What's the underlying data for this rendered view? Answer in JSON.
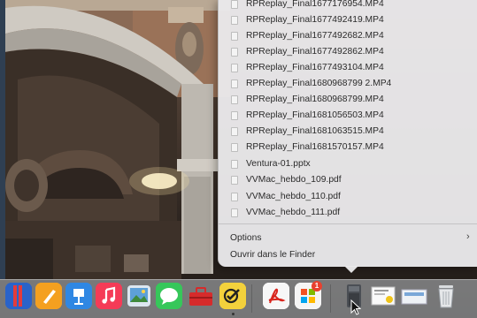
{
  "stack": {
    "files": [
      "RPReplay_Final1677176954.MP4",
      "RPReplay_Final1677492419.MP4",
      "RPReplay_Final1677492682.MP4",
      "RPReplay_Final1677492862.MP4",
      "RPReplay_Final1677493104.MP4",
      "RPReplay_Final1680968799 2.MP4",
      "RPReplay_Final1680968799.MP4",
      "RPReplay_Final1681056503.MP4",
      "RPReplay_Final1681063515.MP4",
      "RPReplay_Final1681570157.MP4",
      "Ventura-01.pptx",
      "VVMac_hebdo_109.pdf",
      "VVMac_hebdo_110.pdf",
      "VVMac_hebdo_111.pdf"
    ],
    "options_label": "Options",
    "open_finder_label": "Ouvrir dans le Finder"
  },
  "dock": {
    "apps": [
      {
        "name": "unknown-red-app",
        "icon": "red-bars-icon"
      },
      {
        "name": "pages",
        "icon": "pencil-icon"
      },
      {
        "name": "keynote",
        "icon": "podium-icon"
      },
      {
        "name": "music",
        "icon": "music-note-icon"
      },
      {
        "name": "preview",
        "icon": "photos-icon"
      },
      {
        "name": "messages",
        "icon": "speech-bubble-icon"
      },
      {
        "name": "toolbox",
        "icon": "toolbox-icon"
      },
      {
        "name": "checklist",
        "icon": "checkmark-icon"
      },
      {
        "name": "acrobat-reader",
        "icon": "pdf-icon"
      },
      {
        "name": "microsoft-office",
        "icon": "office-icon"
      },
      {
        "name": "downloads-stack",
        "icon": "folder-stack-icon"
      },
      {
        "name": "document-stack",
        "icon": "document-icon"
      },
      {
        "name": "screenshot-stack",
        "icon": "screenshot-icon"
      },
      {
        "name": "trash",
        "icon": "trash-icon"
      }
    ],
    "office_badge": "1"
  },
  "colors": {
    "menu_bg": "#eae9eb",
    "text": "#2b2b2b",
    "dock_bg": "#bec3c8"
  }
}
